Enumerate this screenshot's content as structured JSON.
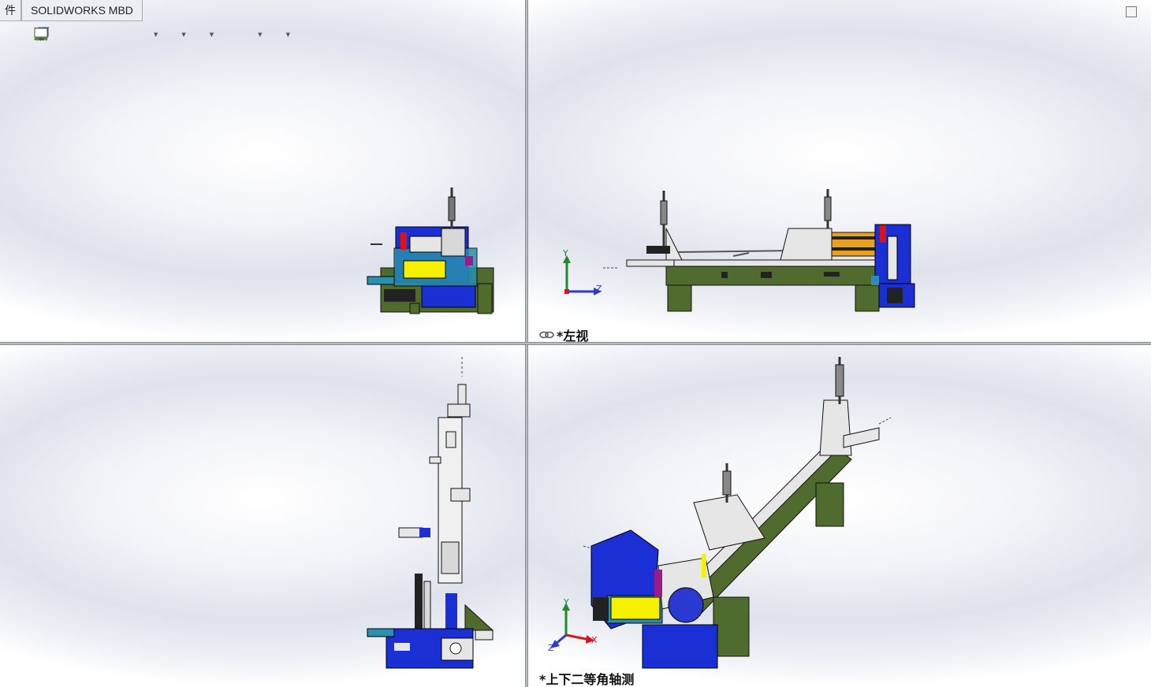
{
  "tabs": [
    {
      "label": "件"
    },
    {
      "label": "SOLIDWORKS MBD"
    }
  ],
  "toolbar": {
    "icons": [
      "zoom-to-fit-icon",
      "zoom-area-icon",
      "previous-view-icon",
      "section-view-icon",
      "dynamic-annotation-icon",
      "view-orientation-icon",
      "display-style-icon",
      "hide-show-icon",
      "edit-appearance-icon",
      "apply-scene-icon",
      "view-settings-icon"
    ]
  },
  "viewports": {
    "top_right": {
      "label": "*左视"
    },
    "bottom_right": {
      "label": "*上下二等角轴测"
    }
  },
  "triad": {
    "x": "X",
    "y": "Y",
    "z": "Z"
  },
  "colors": {
    "frame_green": "#4f6b2e",
    "body_blue": "#1a2fd4",
    "accent_yellow": "#f4f000",
    "accent_magenta": "#9a1a8a",
    "accent_red": "#d8141a",
    "light_gray": "#e6e6e6",
    "cyan": "#2a8fb0"
  }
}
